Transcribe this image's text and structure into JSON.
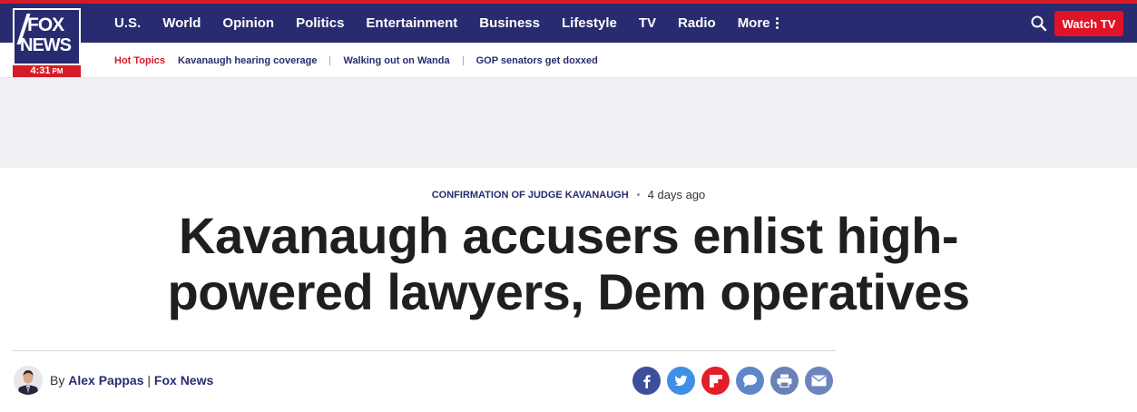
{
  "logo": {
    "line1": "FOX",
    "line2": "NEWS",
    "time": "4:31",
    "ampm": "PM"
  },
  "nav": {
    "links": [
      "U.S.",
      "World",
      "Opinion",
      "Politics",
      "Entertainment",
      "Business",
      "Lifestyle",
      "TV",
      "Radio"
    ],
    "more_label": "More",
    "watch_label": "Watch TV",
    "icons": {
      "search": "search-icon",
      "more": "more-vertical-icon"
    }
  },
  "hot_topics": {
    "label": "Hot Topics",
    "items": [
      "Kavanaugh hearing coverage",
      "Walking out on Wanda",
      "GOP senators get doxxed"
    ]
  },
  "article": {
    "category": "CONFIRMATION OF JUDGE KAVANAUGH",
    "time": "4 days ago",
    "headline": "Kavanaugh accusers enlist high-powered lawyers, Dem operatives",
    "byline": {
      "prefix": "By",
      "author": "Alex Pappas",
      "separator": "|",
      "org": "Fox News"
    }
  },
  "share": {
    "icons": [
      "facebook-icon",
      "twitter-icon",
      "flipboard-icon",
      "comments-icon",
      "print-icon",
      "email-icon"
    ]
  },
  "colors": {
    "navy": "#282b6f",
    "red": "#d61a27",
    "watch_red": "#e01327",
    "ad_bg": "#f0f0f4"
  }
}
